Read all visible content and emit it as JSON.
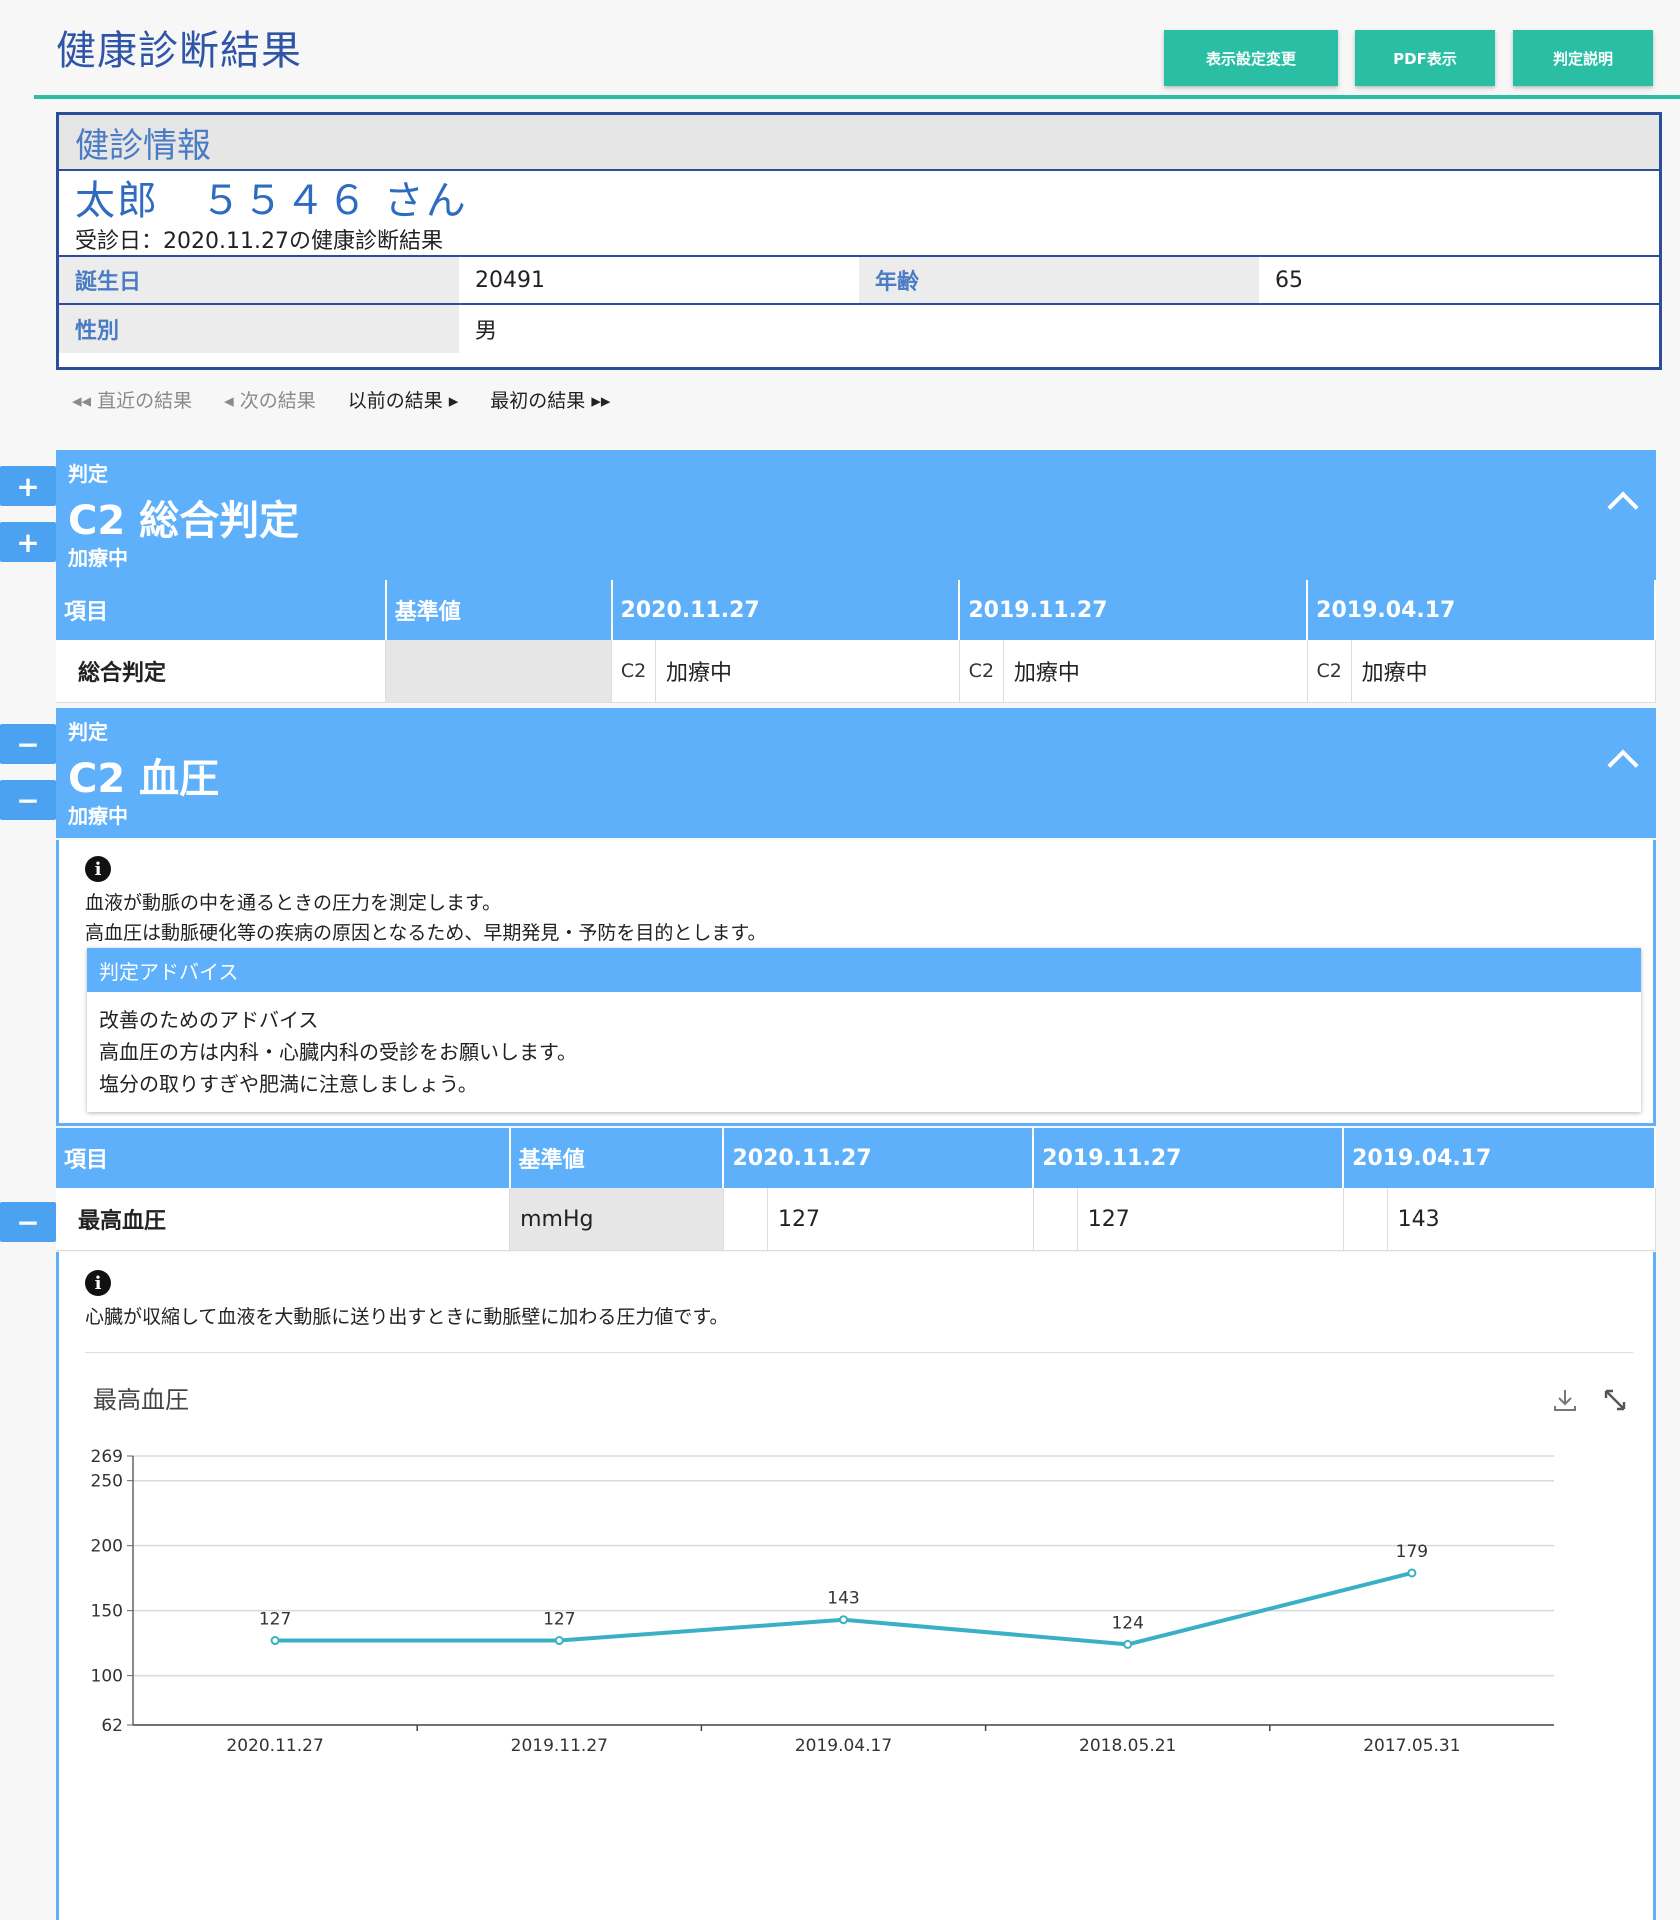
{
  "header": {
    "title": "健康診断結果",
    "buttons": [
      "表示設定変更",
      "PDF表示",
      "判定説明"
    ]
  },
  "info": {
    "heading": "健診情報",
    "patient_name": "太郎　５５４６ さん",
    "exam_date": "受診日：2020.11.27の健康診断結果",
    "fields": [
      {
        "label": "誕生日",
        "value": "20491"
      },
      {
        "label": "年齢",
        "value": "65"
      },
      {
        "label": "性別",
        "value": "男"
      }
    ]
  },
  "nav": {
    "latest": "◂◂ 直近の結果",
    "next": "◂ 次の結果",
    "previous": "以前の結果 ▸",
    "first": "最初の結果 ▸▸"
  },
  "side_buttons": {
    "plus": "+",
    "minus": "−"
  },
  "overall": {
    "label": "判定",
    "title": "C2 総合判定",
    "status": "加療中",
    "columns": [
      "項目",
      "基準値",
      "2020.11.27",
      "2019.11.27",
      "2019.04.17"
    ],
    "row": {
      "name": "総合判定",
      "standard": "",
      "cells": [
        {
          "code": "C2",
          "value": "加療中"
        },
        {
          "code": "C2",
          "value": "加療中"
        },
        {
          "code": "C2",
          "value": "加療中"
        }
      ]
    }
  },
  "bp": {
    "label": "判定",
    "title": "C2 血圧",
    "status": "加療中",
    "description": [
      "血液が動脈の中を通るときの圧力を測定します。",
      "高血圧は動脈硬化等の疾病の原因となるため、早期発見・予防を目的とします。"
    ],
    "advice_heading": "判定アドバイス",
    "advice_lines": [
      "改善のためのアドバイス",
      "高血圧の方は内科・心臓内科の受診をお願いします。",
      "塩分の取りすぎや肥満に注意しましょう。"
    ],
    "columns": [
      "項目",
      "基準値",
      "2020.11.27",
      "2019.11.27",
      "2019.04.17"
    ],
    "row": {
      "name": "最高血圧",
      "standard": "mmHg",
      "cells": [
        {
          "code": "",
          "value": "127"
        },
        {
          "code": "",
          "value": "127"
        },
        {
          "code": "",
          "value": "143"
        }
      ]
    },
    "item_description": "心臓が収縮して血液を大動脈に送り出すときに動脈壁に加わる圧力値です。"
  },
  "chart_data": {
    "type": "line",
    "title": "最高血圧",
    "categories": [
      "2020.11.27",
      "2019.11.27",
      "2019.04.17",
      "2018.05.21",
      "2017.05.31"
    ],
    "series": [
      {
        "values": [
          127,
          127,
          143,
          124,
          179
        ]
      }
    ],
    "ylim": [
      62,
      269
    ],
    "yticks": [
      62,
      100,
      150,
      200,
      250,
      269
    ],
    "grid": true,
    "line_color": "#3ab0c4"
  }
}
